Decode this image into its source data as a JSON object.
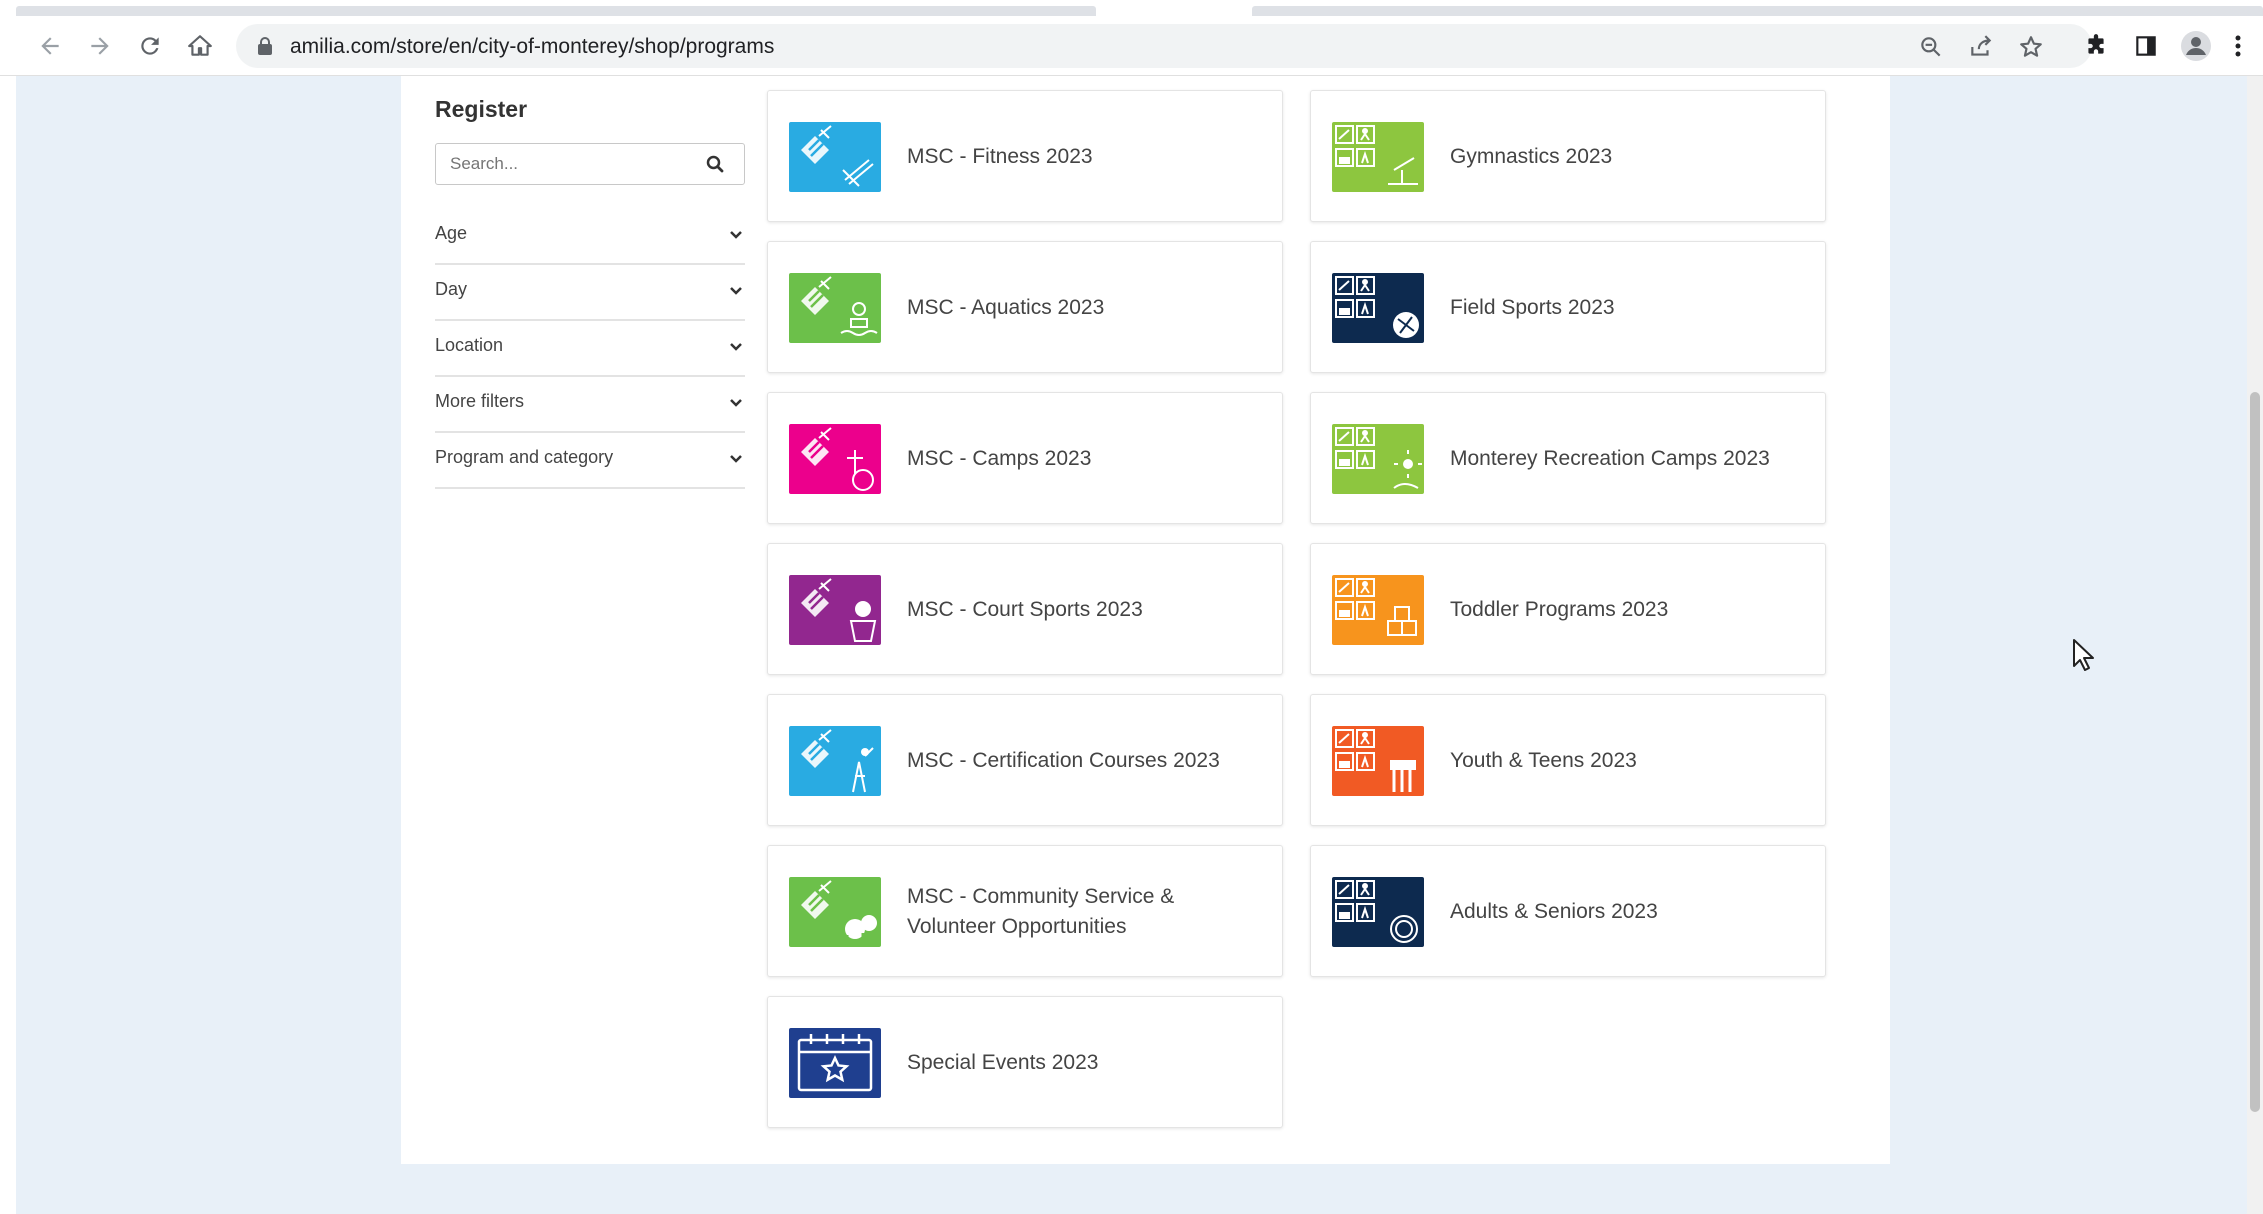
{
  "browser": {
    "url": "amilia.com/store/en/city-of-monterey/shop/programs",
    "icons": [
      "back-icon",
      "forward-icon",
      "reload-icon",
      "home-icon",
      "lock-icon",
      "zoom-icon",
      "share-icon",
      "star-icon",
      "extensions-icon",
      "sidepanel-icon",
      "profile-icon",
      "menu-icon"
    ]
  },
  "sidebar": {
    "title": "Register",
    "search_placeholder": "Search...",
    "filters": [
      {
        "label": "Age"
      },
      {
        "label": "Day"
      },
      {
        "label": "Location"
      },
      {
        "label": "More filters"
      },
      {
        "label": "Program and category"
      }
    ]
  },
  "cards": [
    {
      "title": "MSC - Fitness 2023",
      "color": "#29abe2",
      "style": "msc",
      "icon": "fitness-icon"
    },
    {
      "title": "Gymnastics 2023",
      "color": "#8dc63f",
      "style": "rec",
      "icon": "gymnastics-icon"
    },
    {
      "title": "MSC - Aquatics 2023",
      "color": "#6cc04a",
      "style": "msc",
      "icon": "aquatics-icon"
    },
    {
      "title": "Field Sports 2023",
      "color": "#0d2a4f",
      "style": "rec",
      "icon": "field-sports-icon"
    },
    {
      "title": "MSC - Camps 2023",
      "color": "#ec008c",
      "style": "msc",
      "icon": "camps-icon"
    },
    {
      "title": "Monterey Recreation Camps 2023",
      "color": "#8dc63f",
      "style": "rec",
      "icon": "rec-camps-icon"
    },
    {
      "title": "MSC - Court Sports 2023",
      "color": "#92278f",
      "style": "msc",
      "icon": "court-sports-icon"
    },
    {
      "title": "Toddler Programs 2023",
      "color": "#f7941d",
      "style": "rec",
      "icon": "toddler-icon"
    },
    {
      "title": "MSC - Certification Courses 2023",
      "color": "#29abe2",
      "style": "msc",
      "icon": "certification-icon"
    },
    {
      "title": "Youth & Teens 2023",
      "color": "#f15a24",
      "style": "rec",
      "icon": "youth-icon"
    },
    {
      "title": "MSC - Community Service & Volunteer Opportunities",
      "color": "#6cc04a",
      "style": "msc",
      "icon": "community-icon"
    },
    {
      "title": "Adults & Seniors 2023",
      "color": "#0d2a4f",
      "style": "rec",
      "icon": "adults-icon"
    },
    {
      "title": "Special Events 2023",
      "color": "#1f3f8f",
      "style": "calendar",
      "icon": "calendar-star-icon"
    }
  ]
}
